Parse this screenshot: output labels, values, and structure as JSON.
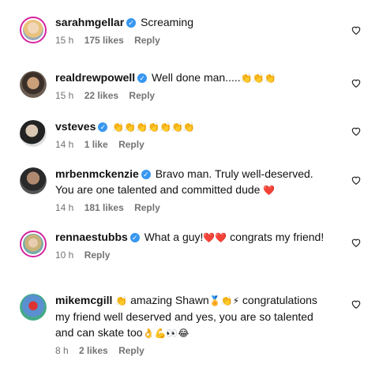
{
  "comments": [
    {
      "user": "sarahmgellar",
      "text": "Screaming",
      "emoji": "",
      "time": "15 h",
      "likes": "175 likes",
      "reply": "Reply"
    },
    {
      "user": "realdrewpowell",
      "text": "Well done man.....",
      "emoji": "👏👏👏",
      "time": "15 h",
      "likes": "22 likes",
      "reply": "Reply"
    },
    {
      "user": "vsteves",
      "text": "",
      "emoji": "👏👏👏👏👏👏👏",
      "time": "14 h",
      "likes": "1 like",
      "reply": "Reply"
    },
    {
      "user": "mrbenmckenzie",
      "text": "Bravo man. Truly well-deserved. You are one talented and committed dude",
      "emoji": "❤️",
      "time": "14 h",
      "likes": "181 likes",
      "reply": "Reply"
    },
    {
      "user": "rennaestubbs",
      "text_before": "What a guy!",
      "emoji": "❤️❤️",
      "text_after": " congrats my friend!",
      "time": "10 h",
      "likes": "",
      "reply": "Reply"
    },
    {
      "user": "mikemcgill",
      "emoji_before": "👏",
      "text_a": " amazing Shawn",
      "emoji_mid": "🏅👏⚡",
      "text_b": " congratulations my friend well deserved and yes, you are so talented and can skate too",
      "emoji_end": "👌💪👀😂",
      "time": "8 h",
      "likes": "2 likes",
      "reply": "Reply"
    }
  ],
  "colors": {
    "ring": "#d6249f",
    "verified": "#3897f0",
    "heart_red": "#e0245e",
    "meta": "#737373"
  },
  "icons": {
    "like": "heart-outline-icon",
    "verified": "verified-badge-icon"
  }
}
